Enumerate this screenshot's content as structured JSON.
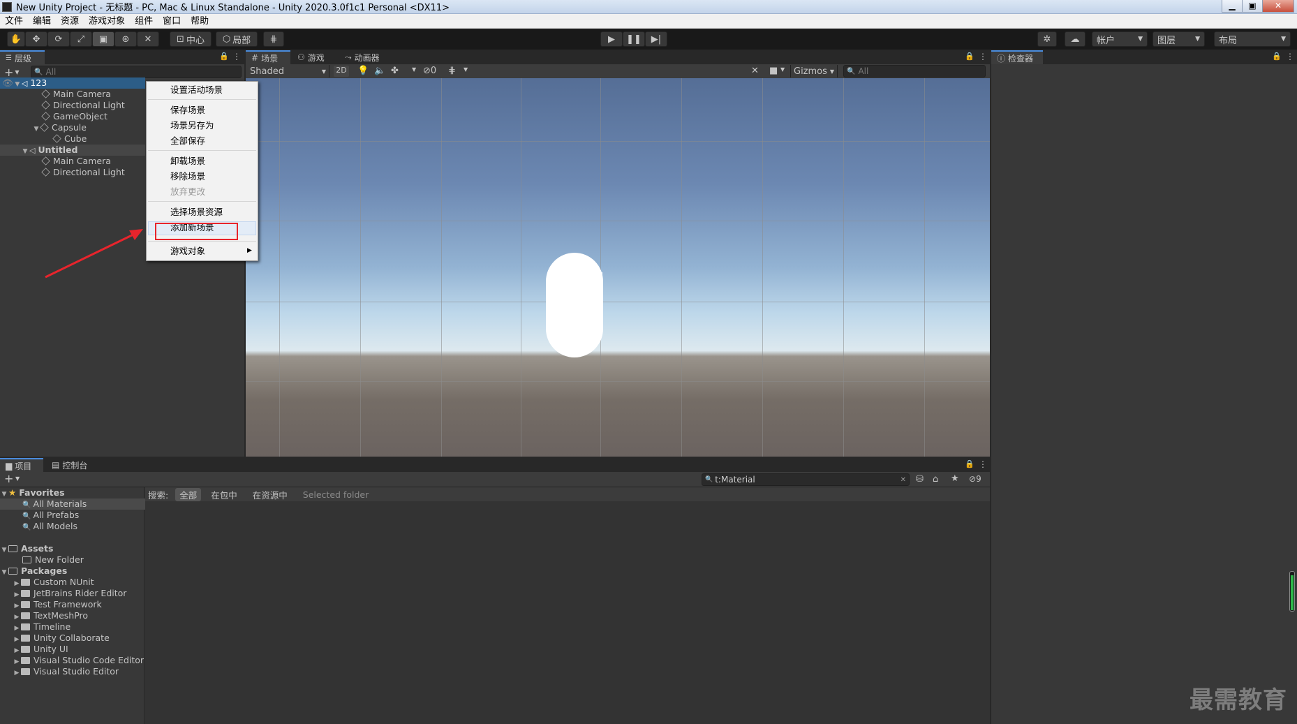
{
  "window": {
    "title": "New Unity Project - 无标题 - PC, Mac & Linux Standalone - Unity 2020.3.0f1c1 Personal <DX11>",
    "minimize": "▁",
    "maximize": "▣",
    "close": "✕"
  },
  "menubar": [
    "文件",
    "编辑",
    "资源",
    "游戏对象",
    "组件",
    "窗口",
    "帮助"
  ],
  "toolbar": {
    "pivot": "中心",
    "space": "局部",
    "account": "帐户",
    "layers": "图层",
    "layout": "布局"
  },
  "hierarchy": {
    "tab": "层级",
    "search_placeholder": "All",
    "rows": [
      {
        "label": "123",
        "kind": "scene",
        "depth": 0
      },
      {
        "label": "Main Camera",
        "kind": "object",
        "depth": 1
      },
      {
        "label": "Directional Light",
        "kind": "object",
        "depth": 1
      },
      {
        "label": "GameObject",
        "kind": "object",
        "depth": 1
      },
      {
        "label": "Capsule",
        "kind": "object",
        "depth": 1
      },
      {
        "label": "Cube",
        "kind": "object",
        "depth": 2
      },
      {
        "label": "Untitled",
        "kind": "scene",
        "depth": 0
      },
      {
        "label": "Main Camera",
        "kind": "object",
        "depth": 1
      },
      {
        "label": "Directional Light",
        "kind": "object",
        "depth": 1
      }
    ]
  },
  "context_menu": {
    "items": [
      {
        "label": "设置活动场景",
        "disabled": false
      },
      {
        "label": "保存场景",
        "disabled": false
      },
      {
        "label": "场景另存为",
        "disabled": false
      },
      {
        "label": "全部保存",
        "disabled": false
      },
      {
        "label": "卸载场景",
        "disabled": false
      },
      {
        "label": "移除场景",
        "disabled": false
      },
      {
        "label": "放弃更改",
        "disabled": true
      },
      {
        "label": "选择场景资源",
        "disabled": false
      },
      {
        "label": "添加新场景",
        "disabled": false,
        "highlighted": true
      },
      {
        "label": "游戏对象",
        "disabled": false,
        "submenu": true
      }
    ]
  },
  "scene_view": {
    "tabs": [
      "场景",
      "游戏",
      "动画器"
    ],
    "shading": "Shaded",
    "mode_2d": "2D",
    "hidden_count": "0",
    "gizmos": "Gizmos",
    "search_placeholder": "All"
  },
  "inspector": {
    "tab": "检查器"
  },
  "project": {
    "tabs": [
      "项目",
      "控制台"
    ],
    "search_value": "t:Material",
    "hidden_count": "9",
    "filter_label": "搜索:",
    "filters": [
      "全部",
      "在包中",
      "在资源中",
      "Selected folder"
    ],
    "favorites_label": "Favorites",
    "favorites": [
      "All Materials",
      "All Prefabs",
      "All Models"
    ],
    "assets_label": "Assets",
    "assets": [
      "New Folder"
    ],
    "packages_label": "Packages",
    "packages": [
      "Custom NUnit",
      "JetBrains Rider Editor",
      "Test Framework",
      "TextMeshPro",
      "Timeline",
      "Unity Collaborate",
      "Unity UI",
      "Visual Studio Code Editor",
      "Visual Studio Editor"
    ]
  },
  "watermark": "最需教育",
  "colors": {
    "accent": "#4a8cdd",
    "highlight_box": "#e8242c",
    "selection": "#2c5d87"
  }
}
